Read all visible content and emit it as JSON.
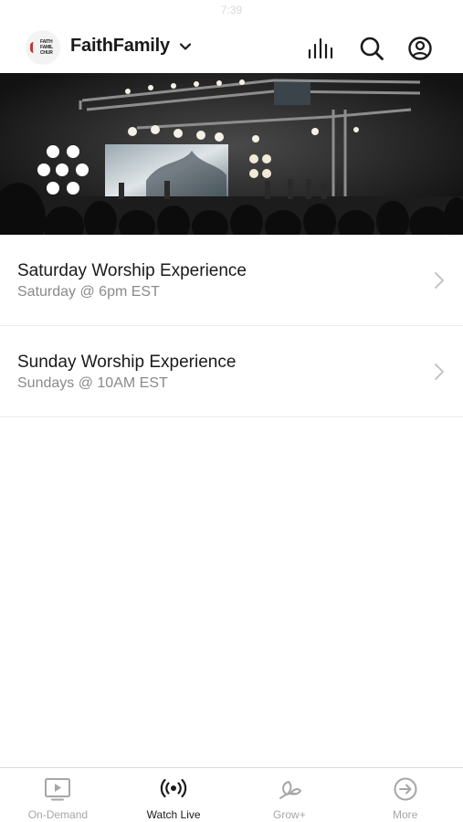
{
  "status_bar": {
    "time": "7:39"
  },
  "header": {
    "logo_text": [
      "FAITH",
      "FAMIL",
      "CHUR"
    ],
    "brand_name": "FaithFamily",
    "icons": [
      "chevron-down-icon",
      "audio-bars-icon",
      "search-icon",
      "account-icon"
    ]
  },
  "banner": {
    "description": "concert-stage-photo"
  },
  "services": [
    {
      "title": "Saturday Worship Experience",
      "subtitle": "Saturday @ 6pm EST"
    },
    {
      "title": "Sunday Worship Experience",
      "subtitle": "Sundays @ 10AM EST"
    }
  ],
  "tabs": [
    {
      "label": "On-Demand",
      "icon": "tv-play-icon",
      "active": false
    },
    {
      "label": "Watch Live",
      "icon": "broadcast-icon",
      "active": true
    },
    {
      "label": "Grow+",
      "icon": "sprout-icon",
      "active": false
    },
    {
      "label": "More",
      "icon": "arrow-circle-icon",
      "active": false
    }
  ],
  "colors": {
    "text": "#1a1a1a",
    "muted": "#8a8a8a",
    "inactive_tab": "#a6a6a6",
    "logo_accent": "#c0392b"
  }
}
